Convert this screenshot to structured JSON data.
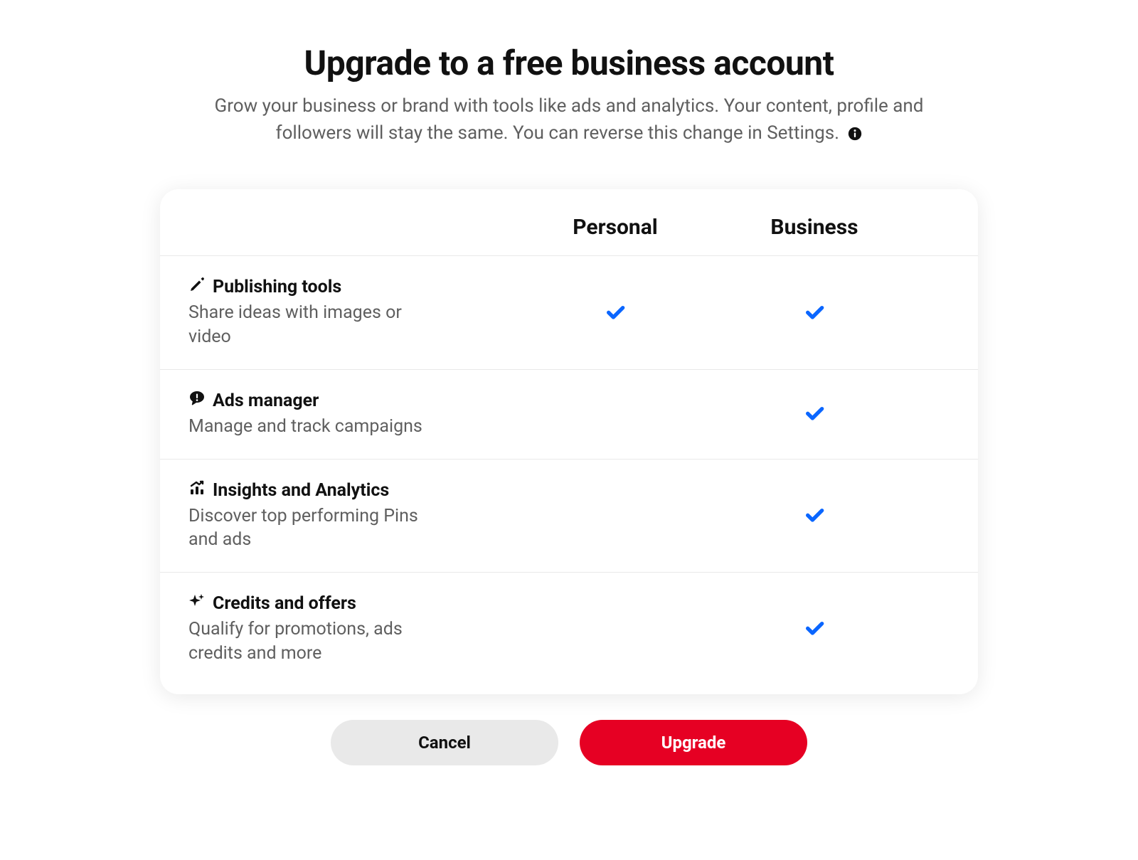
{
  "header": {
    "title": "Upgrade to a free business account",
    "subtitle": "Grow your business or brand with tools like ads and analytics. Your content, profile and followers will stay the same. You can reverse this change in Settings."
  },
  "columns": {
    "personal": "Personal",
    "business": "Business"
  },
  "features": [
    {
      "icon": "pencil-icon",
      "title": "Publishing tools",
      "desc": "Share ideas with images or video",
      "personal": true,
      "business": true
    },
    {
      "icon": "megaphone-icon",
      "title": "Ads manager",
      "desc": "Manage and track campaigns",
      "personal": false,
      "business": true
    },
    {
      "icon": "analytics-icon",
      "title": "Insights and Analytics",
      "desc": "Discover top performing Pins and ads",
      "personal": false,
      "business": true
    },
    {
      "icon": "sparkle-icon",
      "title": "Credits and offers",
      "desc": "Qualify for promotions, ads credits and more",
      "personal": false,
      "business": true
    }
  ],
  "actions": {
    "cancel": "Cancel",
    "upgrade": "Upgrade"
  },
  "colors": {
    "check": "#0a66ff",
    "primary": "#e60023",
    "secondary": "#e9e9e9"
  }
}
